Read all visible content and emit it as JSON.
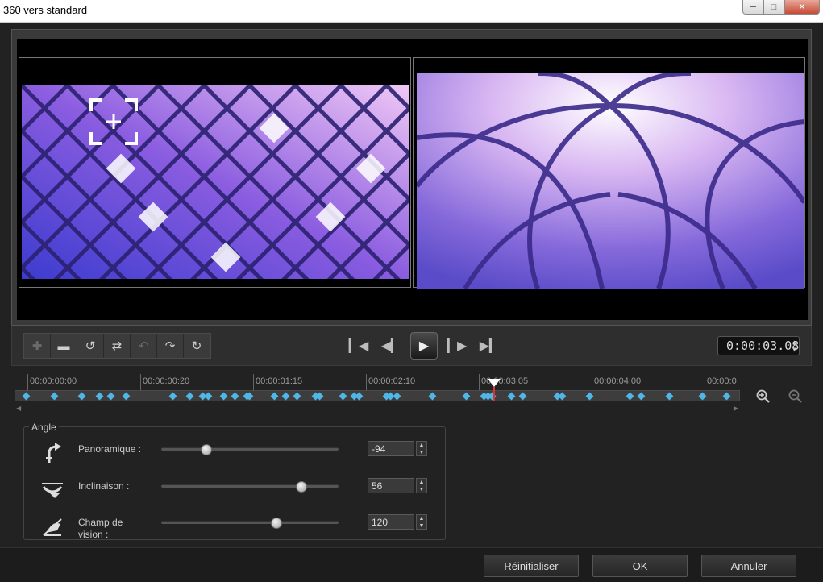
{
  "window": {
    "title": "360 vers standard"
  },
  "toolbar": {
    "timecode": "0:00:03.08"
  },
  "timeline": {
    "ticks": [
      "00:00:00:00",
      "00:00:00:20",
      "00:00:01:15",
      "00:00:02:10",
      "00:00:03:05",
      "00:00:04:00",
      "00:00:0"
    ]
  },
  "angle": {
    "title": "Angle",
    "pan": {
      "label": "Panoramique :",
      "value": "-94",
      "level": 0.24
    },
    "tilt": {
      "label": "Inclinaison :",
      "value": "56",
      "level": 0.81
    },
    "fov": {
      "label_line1": "Champ de",
      "label_line2": "vision :",
      "value": "120",
      "level": 0.66
    }
  },
  "footer": {
    "reset_label": "Réinitialiser",
    "ok_label": "OK",
    "cancel_label": "Annuler"
  },
  "colors": {
    "keyframe": "#4fb6e8",
    "playhead": "#e03030"
  }
}
